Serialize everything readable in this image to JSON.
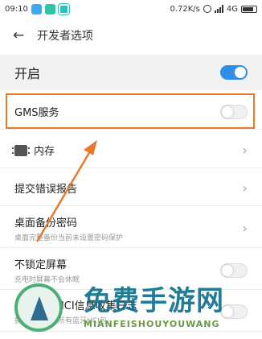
{
  "status_bar": {
    "time": "09:10",
    "net_speed": "0.72K/s",
    "network_type": "4G",
    "network_label": "4G",
    "icons": [
      "cloud-app-icon",
      "grid-app-icon",
      "scan-app-icon",
      "alarm-icon",
      "signal-icon",
      "battery-icon"
    ]
  },
  "header": {
    "back_icon": "back-arrow-icon",
    "title": "开发者选项"
  },
  "master": {
    "label": "开启",
    "toggle": "on"
  },
  "items": [
    {
      "title": "GMS服务",
      "subtitle": "",
      "control": "toggle-off"
    },
    {
      "title": "内存",
      "subtitle": "",
      "control": "chevron",
      "icon": "memory-chip-icon"
    },
    {
      "title": "提交错误报告",
      "subtitle": "",
      "control": "chevron"
    },
    {
      "title": "桌面备份密码",
      "subtitle": "桌面完整备份当前未设置密码保护",
      "control": "chevron"
    },
    {
      "title": "不锁定屏幕",
      "subtitle": "充电时屏幕不会休眠",
      "control": "toggle-off"
    },
    {
      "title": "启用蓝牙HCI信息收集日志",
      "subtitle": "捕获文件中的所有蓝牙HCI包",
      "control": "toggle-off"
    }
  ],
  "colors": {
    "accent": "#2f8fe8",
    "highlight": "#e87a2e"
  },
  "watermark": {
    "text": "免费手游网",
    "url": "MIANFEISHOUYOUWANG"
  }
}
